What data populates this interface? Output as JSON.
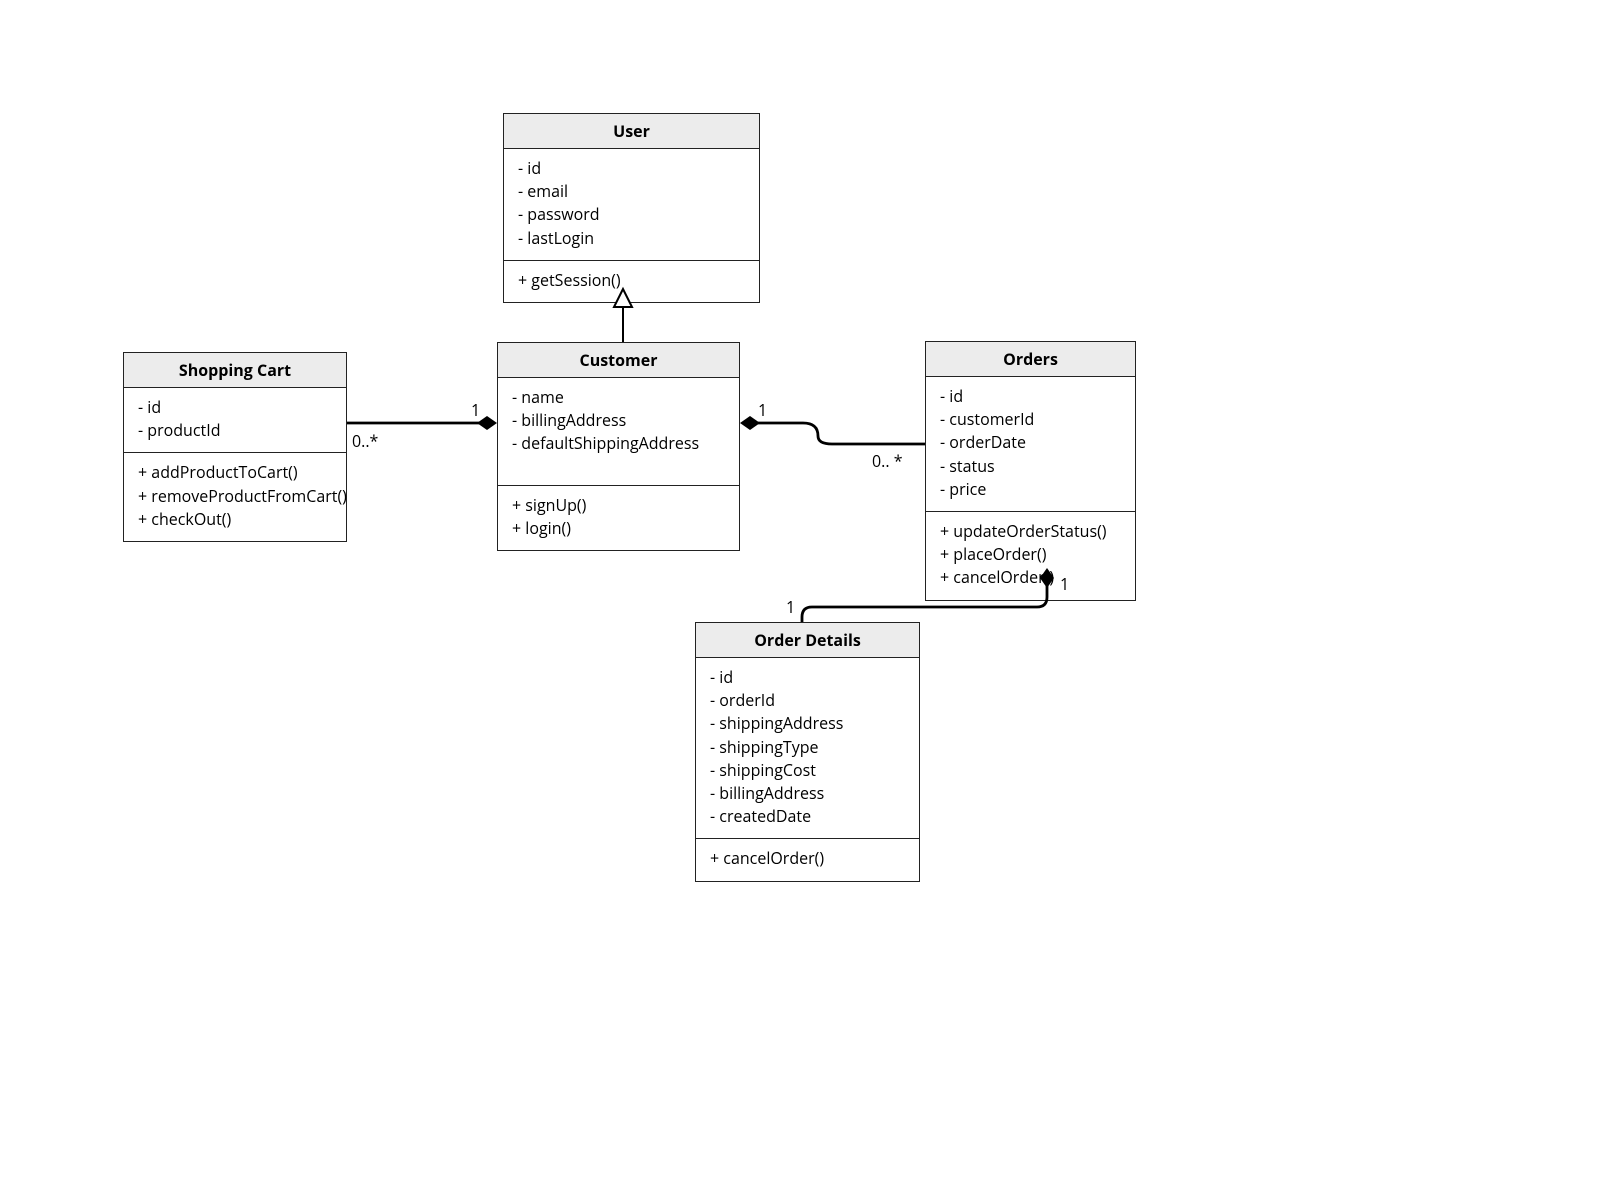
{
  "diagram_type": "UML Class Diagram",
  "classes": {
    "user": {
      "title": "User",
      "attributes": [
        "- id",
        "- email",
        "- password",
        "- lastLogin"
      ],
      "operations": [
        "+ getSession()"
      ]
    },
    "customer": {
      "title": "Customer",
      "attributes": [
        "- name",
        "- billingAddress",
        "- defaultShippingAddress"
      ],
      "operations": [
        "+ signUp()",
        "+ login()"
      ]
    },
    "shopping_cart": {
      "title": "Shopping Cart",
      "attributes": [
        "- id",
        "- productId"
      ],
      "operations": [
        "+ addProductToCart()",
        "+ removeProductFromCart()",
        "+ checkOut()"
      ]
    },
    "orders": {
      "title": "Orders",
      "attributes": [
        "- id",
        "- customerId",
        "- orderDate",
        "- status",
        "- price"
      ],
      "operations": [
        "+ updateOrderStatus()",
        "+ placeOrder()",
        "+ cancelOrder()"
      ]
    },
    "order_details": {
      "title": "Order Details",
      "attributes": [
        "- id",
        "- orderId",
        "- shippingAddress",
        "- shippingType",
        "- shippingCost",
        "- billingAddress",
        "- createdDate"
      ],
      "operations": [
        "+ cancelOrder()"
      ]
    }
  },
  "relations": {
    "user_customer": {
      "type": "generalization",
      "from": "Customer",
      "to": "User"
    },
    "customer_cart": {
      "type": "composition",
      "whole": "Customer",
      "part": "Shopping Cart",
      "whole_mult": "1",
      "part_mult": "0..*"
    },
    "customer_orders": {
      "type": "composition",
      "whole": "Customer",
      "part": "Orders",
      "whole_mult": "1",
      "part_mult": "0.. *"
    },
    "orders_details": {
      "type": "composition",
      "whole": "Orders",
      "part": "Order Details",
      "whole_mult": "1",
      "part_mult": "1"
    }
  },
  "multiplicities": {
    "cust_cart_whole": "1",
    "cust_cart_part": "0..*",
    "cust_orders_whole": "1",
    "cust_orders_part": "0.. *",
    "orders_details_whole": "1",
    "orders_details_part": "1"
  }
}
